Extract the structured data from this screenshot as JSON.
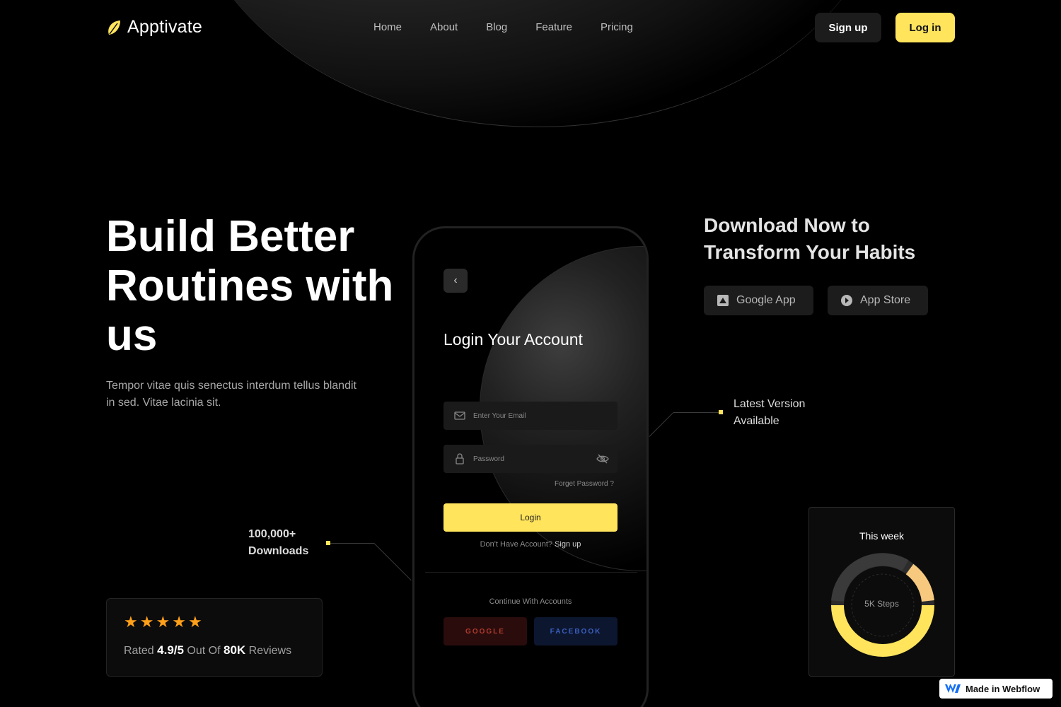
{
  "nav": {
    "brand": "Apptivate",
    "links": [
      "Home",
      "About",
      "Blog",
      "Feature",
      "Pricing"
    ],
    "signup_label": "Sign up",
    "login_label": "Log in"
  },
  "hero": {
    "title": "Build Better Routines with us",
    "subtitle": "Tempor vitae quis senectus interdum tellus blandit in sed. Vitae lacinia sit."
  },
  "downloads_callout": "100,000+ Downloads",
  "rating": {
    "stars": 5,
    "prefix": "Rated",
    "score": "4.9/5",
    "middle": "Out Of",
    "count": "80K",
    "suffix": "Reviews"
  },
  "phone": {
    "title": "Login Your Account",
    "email_placeholder": "Enter Your Email",
    "password_placeholder": "Password",
    "forgot": "Forget Password ?",
    "login_label": "Login",
    "no_account": "Don't Have Account?",
    "signup_link": "Sign up",
    "continue": "Continue With Accounts",
    "google": "GOOGLE",
    "facebook": "FACEBOOK"
  },
  "download_now": {
    "title": "Download Now to Transform Your Habits",
    "google_app": "Google App",
    "app_store": "App Store"
  },
  "latest_version": "Latest Version Available",
  "this_week": {
    "title": "This week",
    "steps": "5K Steps"
  },
  "badge": "Made in Webflow",
  "colors": {
    "accent": "#ffe45c",
    "star": "#ff9f1a",
    "background": "#000000"
  }
}
